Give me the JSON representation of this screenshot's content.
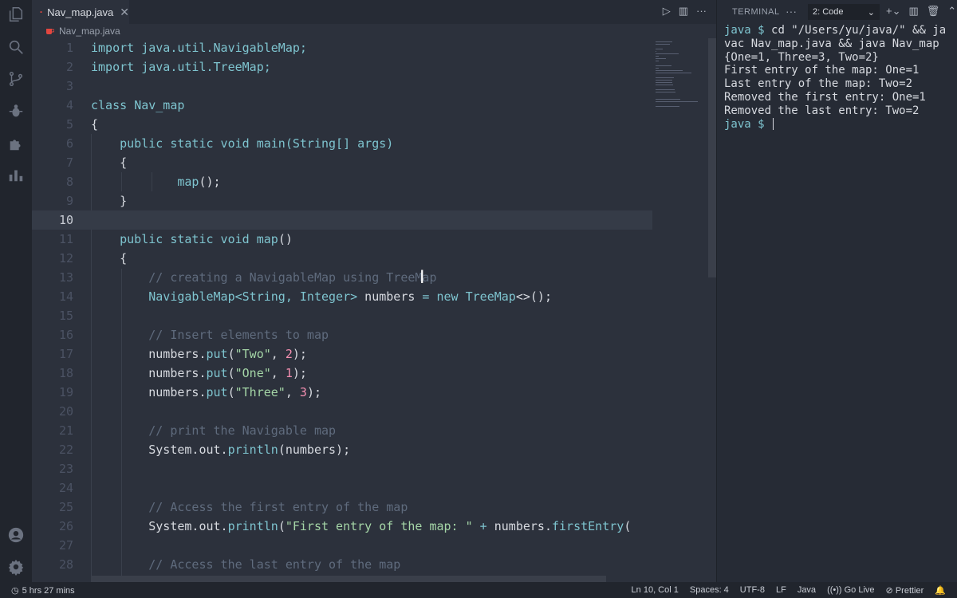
{
  "tab": {
    "filename": "Nav_map.java",
    "close": "✕"
  },
  "breadcrumb": {
    "file": "Nav_map.java"
  },
  "editor": {
    "current_line": 10,
    "lines": [
      {
        "n": "1",
        "tokens": [
          {
            "t": "import ",
            "c": "kw"
          },
          {
            "t": "java.util.NavigableMap;",
            "c": "cls"
          }
        ]
      },
      {
        "n": "2",
        "tokens": [
          {
            "t": "import ",
            "c": "kw"
          },
          {
            "t": "java.util.TreeMap;",
            "c": "cls"
          }
        ]
      },
      {
        "n": "3",
        "tokens": []
      },
      {
        "n": "4",
        "tokens": [
          {
            "t": "class ",
            "c": "kw"
          },
          {
            "t": "Nav_map",
            "c": "cls"
          }
        ]
      },
      {
        "n": "5",
        "tokens": [
          {
            "t": "{",
            "c": "pl"
          }
        ]
      },
      {
        "n": "6",
        "tokens": [
          {
            "t": "    public static void ",
            "c": "kw"
          },
          {
            "t": "main",
            "c": "fn"
          },
          {
            "t": "(String[] args)",
            "c": "cls"
          }
        ]
      },
      {
        "n": "7",
        "tokens": [
          {
            "t": "    {",
            "c": "pl"
          }
        ]
      },
      {
        "n": "8",
        "tokens": [
          {
            "t": "            ",
            "c": "pl"
          },
          {
            "t": "map",
            "c": "fn"
          },
          {
            "t": "();",
            "c": "pl"
          }
        ]
      },
      {
        "n": "9",
        "tokens": [
          {
            "t": "    }",
            "c": "pl"
          }
        ]
      },
      {
        "n": "10",
        "tokens": []
      },
      {
        "n": "11",
        "tokens": [
          {
            "t": "    public static void ",
            "c": "kw"
          },
          {
            "t": "map",
            "c": "fn"
          },
          {
            "t": "()",
            "c": "pl"
          }
        ]
      },
      {
        "n": "12",
        "tokens": [
          {
            "t": "    {",
            "c": "pl"
          }
        ]
      },
      {
        "n": "13",
        "tokens": [
          {
            "t": "        // creating a NavigableMap using TreeMap",
            "c": "cm"
          }
        ]
      },
      {
        "n": "14",
        "tokens": [
          {
            "t": "        NavigableMap<String, Integer> ",
            "c": "cls"
          },
          {
            "t": "numbers ",
            "c": "pl"
          },
          {
            "t": "= new ",
            "c": "kw"
          },
          {
            "t": "TreeMap",
            "c": "cls"
          },
          {
            "t": "<>();",
            "c": "pl"
          }
        ]
      },
      {
        "n": "15",
        "tokens": []
      },
      {
        "n": "16",
        "tokens": [
          {
            "t": "        // Insert elements to map",
            "c": "cm"
          }
        ]
      },
      {
        "n": "17",
        "tokens": [
          {
            "t": "        numbers.",
            "c": "pl"
          },
          {
            "t": "put",
            "c": "fn"
          },
          {
            "t": "(",
            "c": "pl"
          },
          {
            "t": "\"Two\"",
            "c": "str"
          },
          {
            "t": ", ",
            "c": "pl"
          },
          {
            "t": "2",
            "c": "num"
          },
          {
            "t": ");",
            "c": "pl"
          }
        ]
      },
      {
        "n": "18",
        "tokens": [
          {
            "t": "        numbers.",
            "c": "pl"
          },
          {
            "t": "put",
            "c": "fn"
          },
          {
            "t": "(",
            "c": "pl"
          },
          {
            "t": "\"One\"",
            "c": "str"
          },
          {
            "t": ", ",
            "c": "pl"
          },
          {
            "t": "1",
            "c": "num"
          },
          {
            "t": ");",
            "c": "pl"
          }
        ]
      },
      {
        "n": "19",
        "tokens": [
          {
            "t": "        numbers.",
            "c": "pl"
          },
          {
            "t": "put",
            "c": "fn"
          },
          {
            "t": "(",
            "c": "pl"
          },
          {
            "t": "\"Three\"",
            "c": "str"
          },
          {
            "t": ", ",
            "c": "pl"
          },
          {
            "t": "3",
            "c": "num"
          },
          {
            "t": ");",
            "c": "pl"
          }
        ]
      },
      {
        "n": "20",
        "tokens": []
      },
      {
        "n": "21",
        "tokens": [
          {
            "t": "        // print the Navigable map",
            "c": "cm"
          }
        ]
      },
      {
        "n": "22",
        "tokens": [
          {
            "t": "        System.out.",
            "c": "pl"
          },
          {
            "t": "println",
            "c": "fn"
          },
          {
            "t": "(numbers);",
            "c": "pl"
          }
        ]
      },
      {
        "n": "23",
        "tokens": []
      },
      {
        "n": "24",
        "tokens": []
      },
      {
        "n": "25",
        "tokens": [
          {
            "t": "        // Access the first entry of the map",
            "c": "cm"
          }
        ]
      },
      {
        "n": "26",
        "tokens": [
          {
            "t": "        System.out.",
            "c": "pl"
          },
          {
            "t": "println",
            "c": "fn"
          },
          {
            "t": "(",
            "c": "pl"
          },
          {
            "t": "\"First entry of the map: \"",
            "c": "str"
          },
          {
            "t": " + ",
            "c": "kw"
          },
          {
            "t": "numbers.",
            "c": "pl"
          },
          {
            "t": "firstEntry",
            "c": "fn"
          },
          {
            "t": "(",
            "c": "pl"
          }
        ]
      },
      {
        "n": "27",
        "tokens": []
      },
      {
        "n": "28",
        "tokens": [
          {
            "t": "        // Access the last entry of the map",
            "c": "cm"
          }
        ]
      }
    ]
  },
  "terminal": {
    "title": "TERMINAL",
    "more": "···",
    "selected_shell": "2: Code",
    "lines": [
      {
        "prompt": "java $ ",
        "text": "cd \"/Users/yu/java/\" && javac Nav_map.java && java Nav_map"
      },
      {
        "prompt": "",
        "text": "{One=1, Three=3, Two=2}"
      },
      {
        "prompt": "",
        "text": "First entry of the map: One=1"
      },
      {
        "prompt": "",
        "text": "Last entry of the map: Two=2"
      },
      {
        "prompt": "",
        "text": "Removed the first entry: One=1"
      },
      {
        "prompt": "",
        "text": "Removed the last entry: Two=2"
      },
      {
        "prompt": "java $ ",
        "text": ""
      }
    ]
  },
  "status": {
    "time": "5 hrs 27 mins",
    "position": "Ln 10, Col 1",
    "spaces": "Spaces: 4",
    "encoding": "UTF-8",
    "eol": "LF",
    "language": "Java",
    "golive": "Go Live",
    "prettier": "Prettier"
  },
  "colors": {
    "accent": "#7ec4cf",
    "string": "#a5d6a7",
    "number": "#f48fb1",
    "comment": "#5f6b7d",
    "java_icon": "#e2463f"
  }
}
